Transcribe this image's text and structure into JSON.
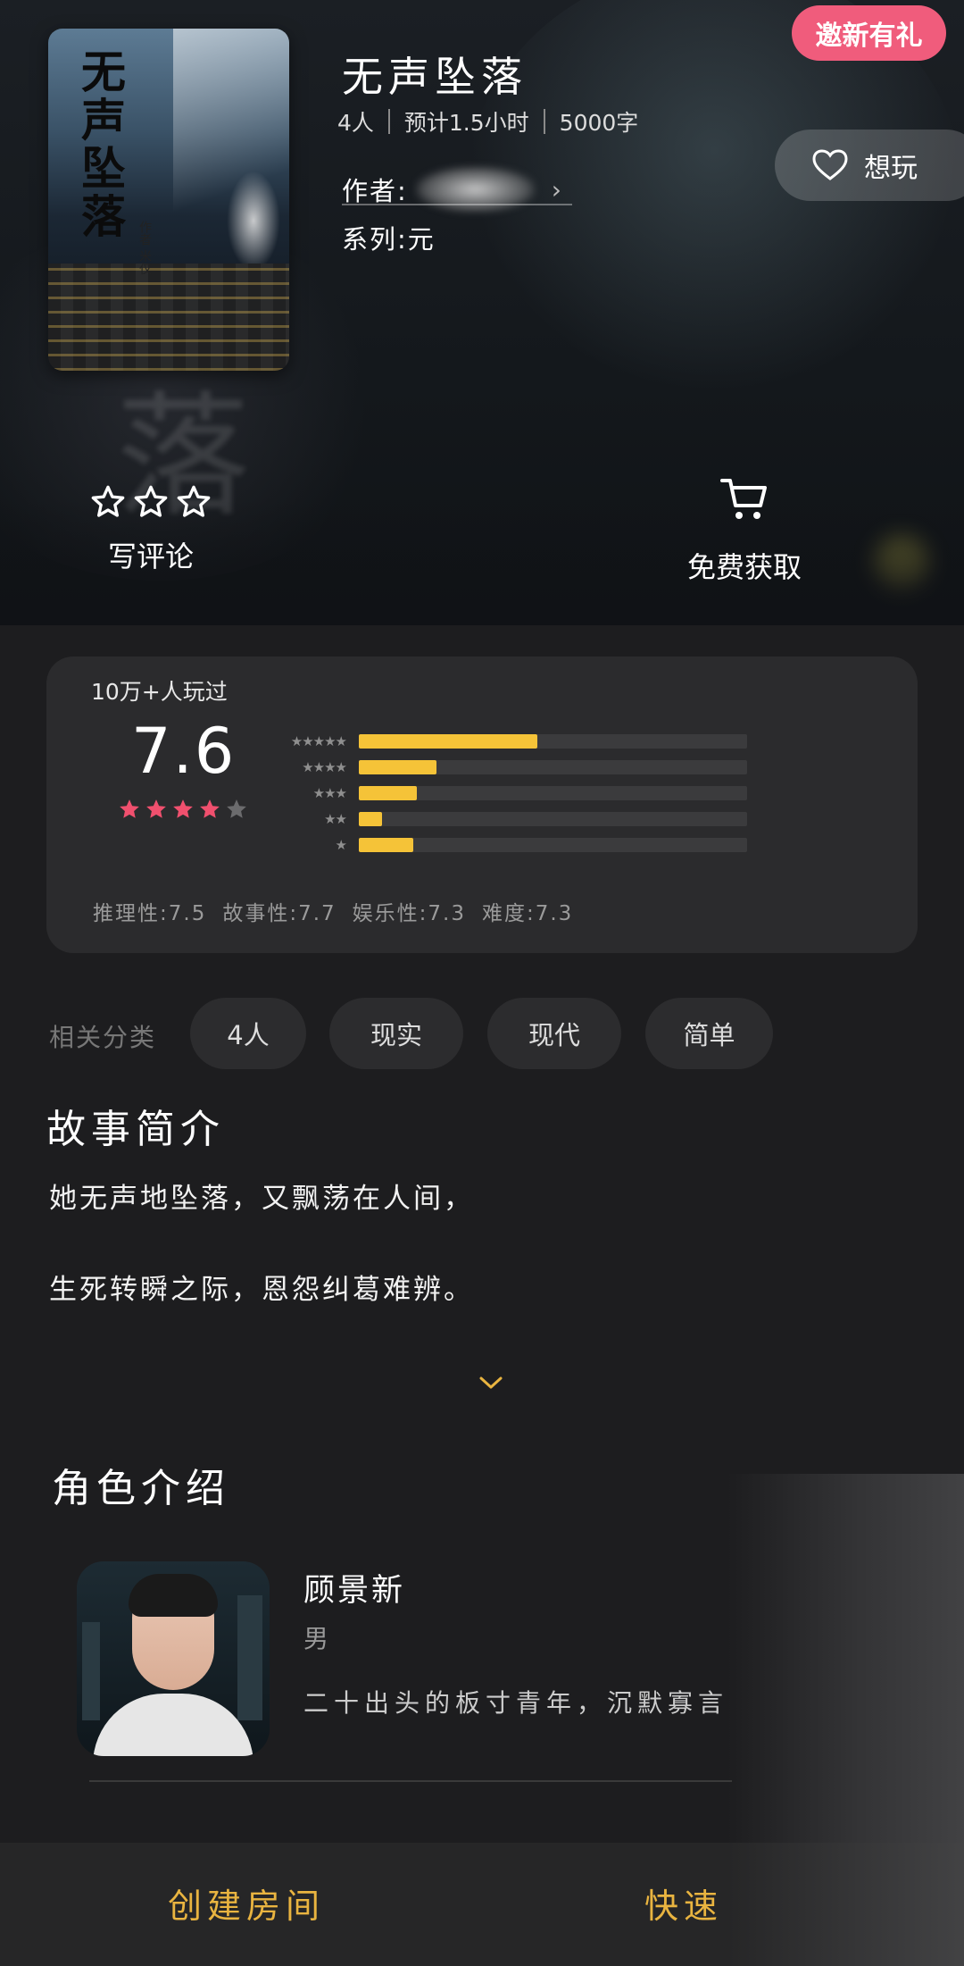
{
  "header": {
    "invite_label": "邀新有礼",
    "want_label": "想玩",
    "cover_title": "无声坠落",
    "cover_author": "作者 米仅"
  },
  "game": {
    "title": "无声坠落",
    "players": "4人",
    "duration": "预计1.5小时",
    "words": "5000字",
    "author_label": "作者:",
    "series_label": "系列:元"
  },
  "actions": {
    "review_label": "写评论",
    "get_label": "免费获取"
  },
  "rating": {
    "played_text": "10万+人玩过",
    "score": "7.6",
    "score_stars": 4,
    "distribution": [
      {
        "stars": 5,
        "fraction": 0.46
      },
      {
        "stars": 4,
        "fraction": 0.2
      },
      {
        "stars": 3,
        "fraction": 0.15
      },
      {
        "stars": 2,
        "fraction": 0.06
      },
      {
        "stars": 1,
        "fraction": 0.14
      }
    ],
    "metrics": [
      "推理性:7.5",
      "故事性:7.7",
      "娱乐性:7.3",
      "难度:7.3"
    ]
  },
  "tags": {
    "label": "相关分类",
    "items": [
      "4人",
      "现实",
      "现代",
      "简单"
    ]
  },
  "story": {
    "title": "故事简介",
    "lines": [
      "她无声地坠落，又飘荡在人间，",
      "生死转瞬之际，恩怨纠葛难辨。"
    ]
  },
  "characters": {
    "title": "角色介绍",
    "items": [
      {
        "name": "顾景新",
        "gender": "男",
        "desc": "二十出头的板寸青年，沉默寡言"
      }
    ]
  },
  "bottom": {
    "create_room": "创建房间",
    "quick": "快速"
  },
  "colors": {
    "accent_pink": "#f05c7c",
    "gold": "#e9b440",
    "bar_fill": "#f5c338",
    "star_pink": "#f0506e"
  }
}
